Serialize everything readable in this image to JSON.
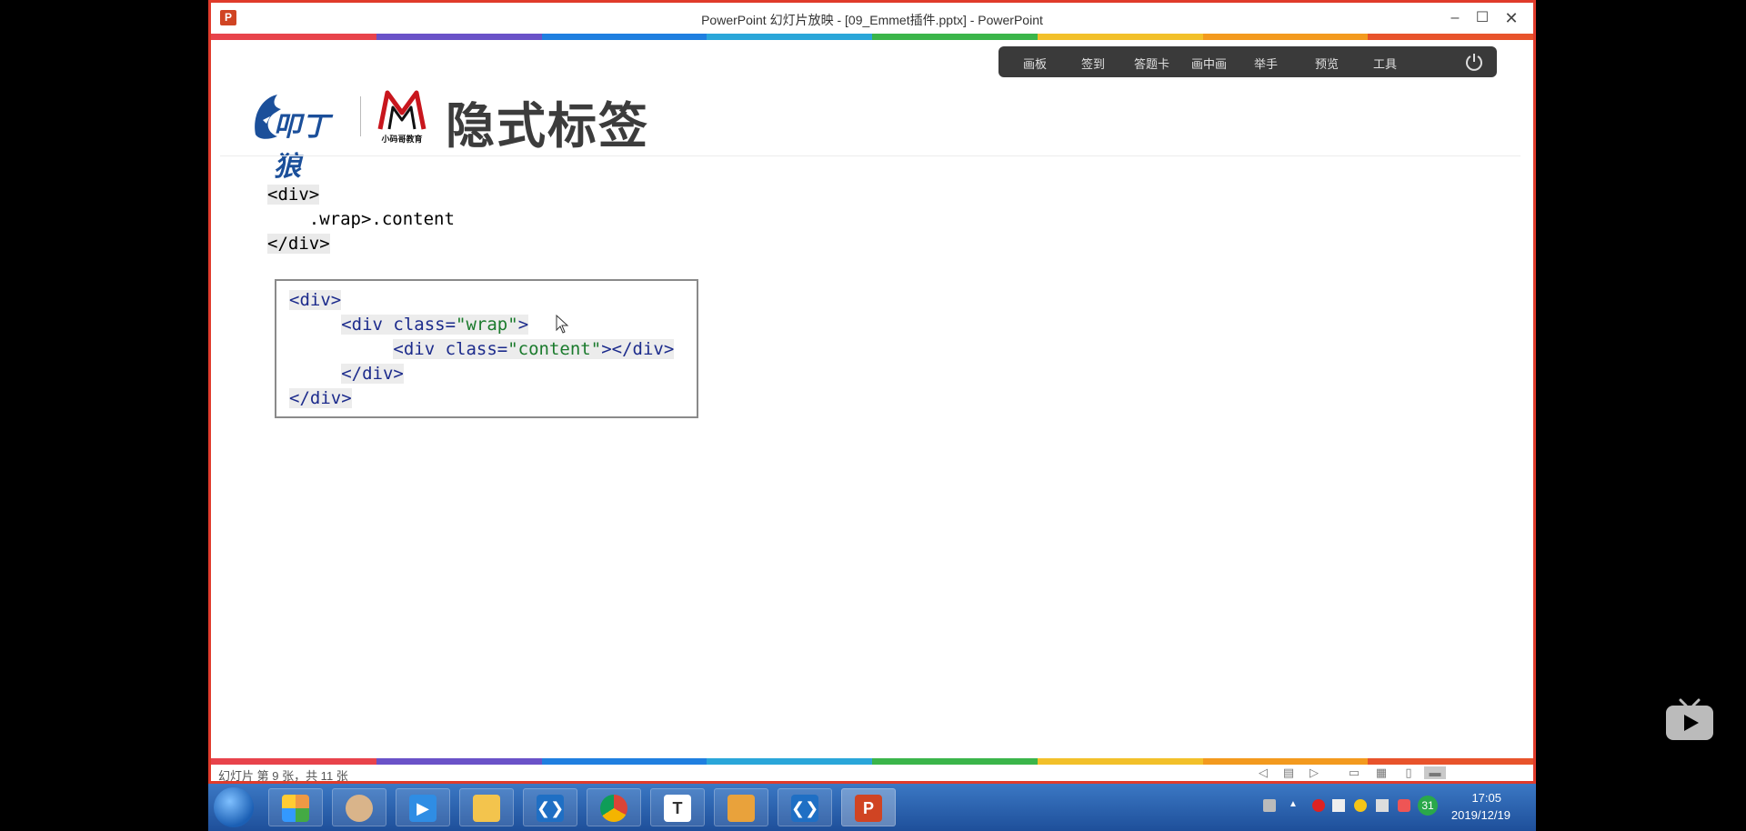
{
  "window": {
    "title": "PowerPoint 幻灯片放映 - [09_Emmet插件.pptx] - PowerPoint",
    "app_icon": "P",
    "minimize": "–",
    "maximize": "☐",
    "close": "✕"
  },
  "toolbar": {
    "items": [
      "画板",
      "签到",
      "答题卡",
      "画中画",
      "举手",
      "预览",
      "工具"
    ]
  },
  "slide": {
    "logo1_text": "叩丁狼",
    "logo2_caption": "小码哥教育",
    "title": "隐式标签",
    "emmet_lines": [
      "<div>",
      "    .wrap>.content",
      "</div>"
    ],
    "output_lines": {
      "l1": "<div>",
      "l2_open": "<div ",
      "l2_attr": "class=",
      "l2_val": "\"wrap\"",
      "l2_close": ">",
      "l3_open": "<div ",
      "l3_attr": "class=",
      "l3_val": "\"content\"",
      "l3_close": "></div>",
      "l4": "</div>",
      "l5": "</div>"
    }
  },
  "statusbar": {
    "text": "幻灯片 第 9 张，共 11 张"
  },
  "taskbar": {
    "apps": [
      "task-app1",
      "task-avatar",
      "task-app3",
      "task-explorer",
      "task-vscode",
      "task-chrome",
      "task-typora",
      "task-app8",
      "task-vscode2",
      "task-powerpoint"
    ],
    "clock_time": "17:05",
    "clock_date": "2019/12/19",
    "calendar_badge": "31"
  },
  "colors": {
    "rainbow": [
      "#e8434b",
      "#6a52c8",
      "#1f7fe0",
      "#2aa6d9",
      "#3bb54a",
      "#f2c02a",
      "#f39a1e",
      "#e8532b"
    ],
    "frame": "#e03b2b"
  }
}
